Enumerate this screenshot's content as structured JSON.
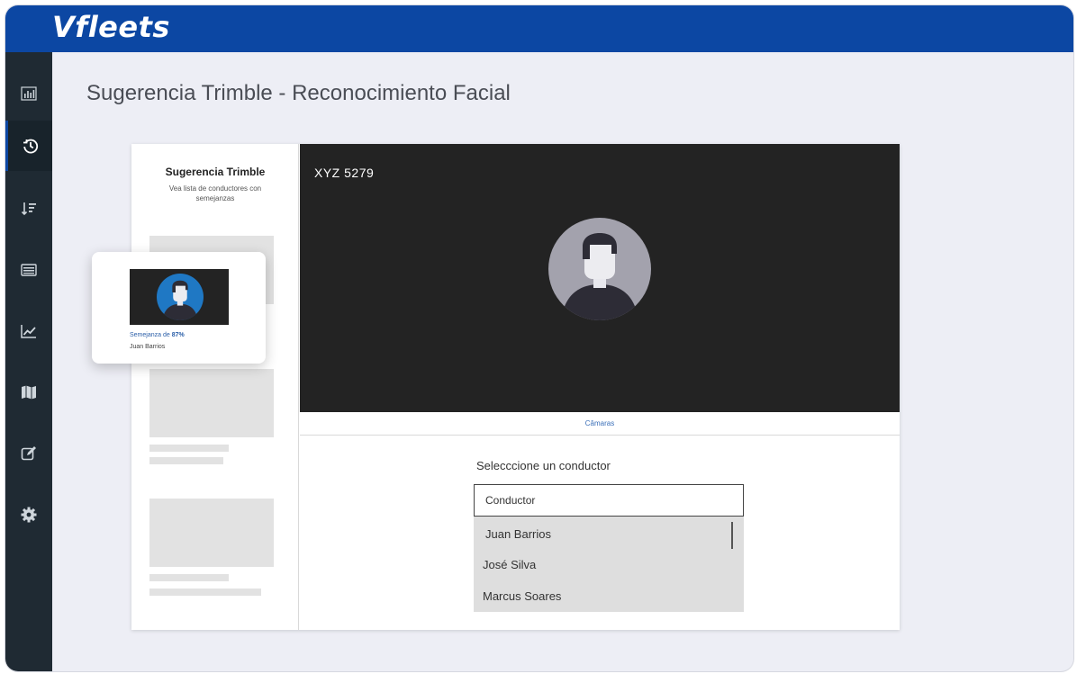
{
  "app": {
    "logo": "Vfleets",
    "page_title": "Sugerencia Trimble - Reconocimiento Facial"
  },
  "colors": {
    "brand_blue": "#0c47a3",
    "sidebar": "#1f2a33",
    "camera_bg": "#232323",
    "link_blue": "#3a6fb8"
  },
  "sidebar": {
    "items": [
      {
        "icon": "bar-chart-icon",
        "active": false
      },
      {
        "icon": "history-clock-icon",
        "active": true
      },
      {
        "icon": "sort-list-icon",
        "active": false
      },
      {
        "icon": "list-icon",
        "active": false
      },
      {
        "icon": "trend-line-icon",
        "active": false
      },
      {
        "icon": "map-icon",
        "active": false
      },
      {
        "icon": "edit-icon",
        "active": false
      },
      {
        "icon": "gear-icon",
        "active": false
      }
    ]
  },
  "suggestion": {
    "title": "Sugerencia Trimble",
    "subtitle": "Vea lista de conductores con semejanzas"
  },
  "floating_card": {
    "similarity_prefix": "Semejanza de ",
    "similarity_value": "87%",
    "driver_name": "Juan Barrios"
  },
  "camera": {
    "plate": "XYZ 5279",
    "tab_label": "Câmaras"
  },
  "driver_select": {
    "label": "Selecccione un conductor",
    "placeholder": "Conductor",
    "options": [
      "Juan Barrios",
      "José Silva",
      "Marcus Soares"
    ]
  }
}
